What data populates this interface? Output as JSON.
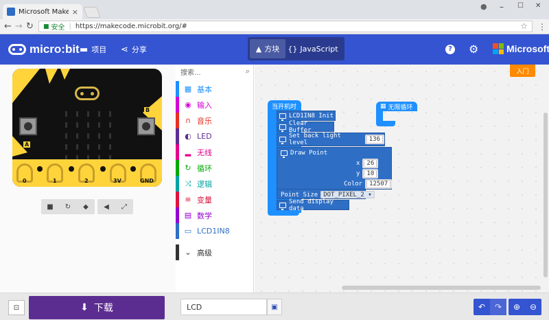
{
  "browser": {
    "tab_title": "Microsoft MakeCod",
    "tab_close": "×",
    "minimize": "–",
    "maximize": "☐",
    "close": "✕",
    "secure_label": "安全",
    "url": "https://makecode.microbit.org/#"
  },
  "header": {
    "brand": "micro:bit",
    "projects_label": "项目",
    "share_label": "分享",
    "blocks_tab": "方块",
    "js_tab": "JavaScript",
    "help_icon": "?",
    "settings_icon": "⚙",
    "microsoft": "Microsoft",
    "accent": "#3454d1"
  },
  "simulator": {
    "button_a": "A",
    "button_b": "B",
    "pins": [
      "0",
      "1",
      "2",
      "3V",
      "GND"
    ]
  },
  "toolbox": {
    "search_placeholder": "搜索...",
    "categories": [
      {
        "label": "基本",
        "icon": "grid-icon",
        "color": "#1e90ff"
      },
      {
        "label": "输入",
        "icon": "target-icon",
        "color": "#d400d4"
      },
      {
        "label": "音乐",
        "icon": "headphones-icon",
        "color": "#e63022"
      },
      {
        "label": "LED",
        "icon": "toggle-icon",
        "color": "#5c2d91"
      },
      {
        "label": "无线",
        "icon": "signal-icon",
        "color": "#e3008c"
      },
      {
        "label": "循环",
        "icon": "loop-icon",
        "color": "#00aa00"
      },
      {
        "label": "逻辑",
        "icon": "shuffle-icon",
        "color": "#00a4a6"
      },
      {
        "label": "变量",
        "icon": "lines-icon",
        "color": "#dc143c"
      },
      {
        "label": "数学",
        "icon": "calculator-icon",
        "color": "#9400d3"
      },
      {
        "label": "LCD1IN8",
        "icon": "monitor-icon",
        "color": "#2e6ec5"
      },
      {
        "label": "高级",
        "icon": "chevron-down-icon",
        "color": "#333333"
      }
    ]
  },
  "workspace": {
    "start_button": "入门",
    "on_start_label": "当开机时",
    "forever_label": "无限循环",
    "blocks": {
      "init": "LCD1IN8 Init",
      "clear": "Clear Buffer",
      "backlight": "Set back light level",
      "backlight_value": "136",
      "draw_point": "Draw Point",
      "x_label": "x",
      "x_value": "26",
      "y_label": "y",
      "y_value": "10",
      "color_label": "Color",
      "color_value": "12507",
      "point_size_label": "Point Size",
      "point_size_value": "DOT_PIXEL_2",
      "send": "Send display data"
    }
  },
  "footer": {
    "download_label": "下载",
    "project_name": "LCD"
  }
}
